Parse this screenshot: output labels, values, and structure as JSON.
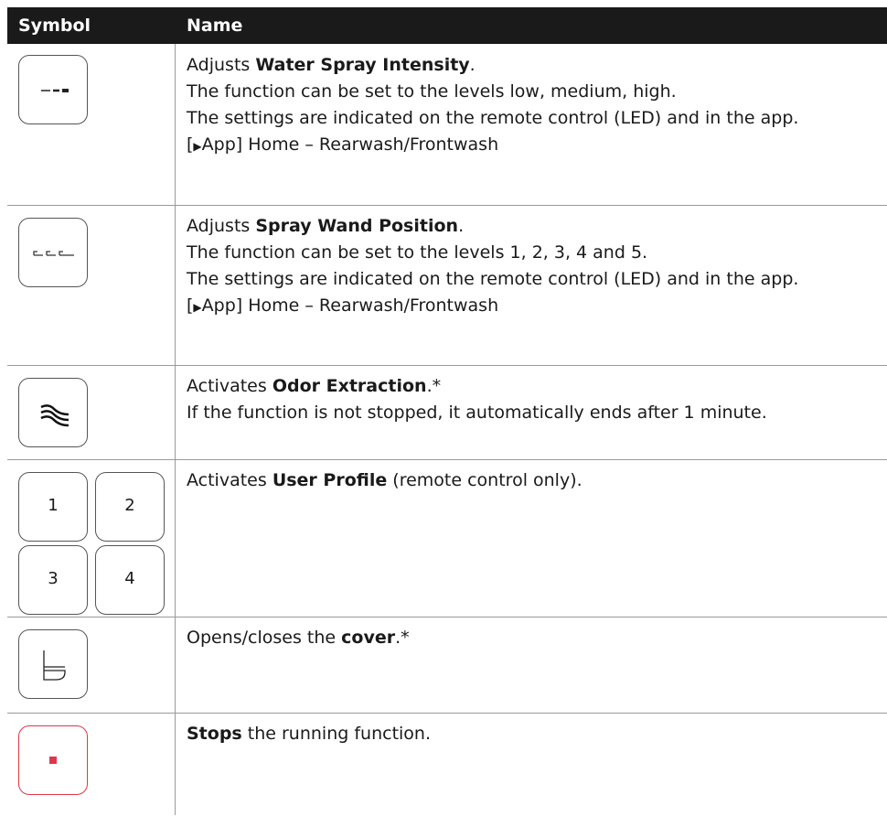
{
  "header": {
    "col_symbol": "Symbol",
    "col_name": "Name"
  },
  "rows": [
    {
      "icon": "spray-intensity-icon",
      "lines": [
        {
          "pre": "Adjusts ",
          "bold": "Water Spray Intensity",
          "post": "."
        },
        {
          "text": "The function can be set to the levels low, medium, high."
        },
        {
          "text": "The settings are indicated on the remote control (LED) and in the app."
        },
        {
          "pre": "[",
          "arrow": "▶",
          "post": "App] Home – Rearwash/Frontwash"
        }
      ]
    },
    {
      "icon": "spray-wand-position-icon",
      "lines": [
        {
          "pre": "Adjusts ",
          "bold": "Spray Wand Position",
          "post": "."
        },
        {
          "text": "The function can be set to the levels 1, 2, 3, 4 and 5."
        },
        {
          "text": "The settings are indicated on the remote control (LED) and in the app."
        },
        {
          "pre": "[",
          "arrow": "▶",
          "post": "App] Home – Rearwash/Frontwash"
        }
      ]
    },
    {
      "icon": "odor-extraction-icon",
      "lines": [
        {
          "pre": "Activates ",
          "bold": "Odor Extraction",
          "post": ".*"
        },
        {
          "text": "If the function is not stopped, it automatically ends after 1 minute."
        }
      ]
    },
    {
      "icon": "user-profile-icon",
      "profile_numbers": [
        "1",
        "2",
        "3",
        "4"
      ],
      "lines": [
        {
          "pre": "Activates ",
          "bold": "User Profile",
          "post": " (remote control only)."
        }
      ]
    },
    {
      "icon": "cover-icon",
      "lines": [
        {
          "pre": "Opens/closes the ",
          "bold": "cover",
          "post": ".*"
        }
      ]
    },
    {
      "icon": "stop-icon",
      "lines": [
        {
          "pre": "",
          "bold": "Stops",
          "post": " the running function."
        }
      ]
    }
  ],
  "colors": {
    "header_bg": "#1a1a1a",
    "stop_accent": "#e0364a",
    "border": "#9a9a9a"
  }
}
